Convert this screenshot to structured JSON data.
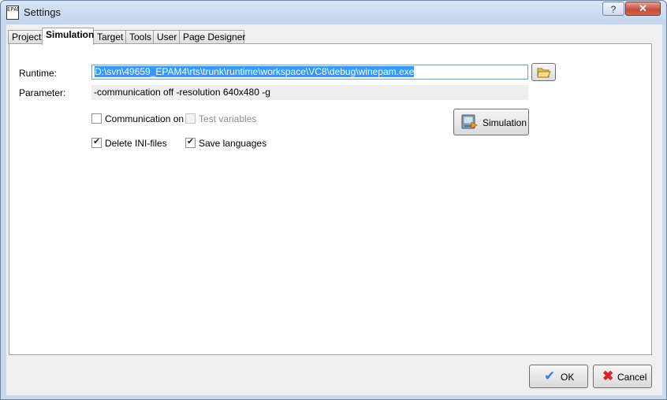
{
  "window": {
    "title": "Settings",
    "app_icon_text": "EPAM",
    "help_glyph": "?",
    "close_glyph": "✕"
  },
  "tabs": [
    {
      "label": "Project"
    },
    {
      "label": "Simulation",
      "active": true
    },
    {
      "label": "Target"
    },
    {
      "label": "Tools"
    },
    {
      "label": "User"
    },
    {
      "label": "Page Designer"
    }
  ],
  "form": {
    "runtime_label": "Runtime:",
    "runtime_value": "D:\\svn\\49659_EPAM4\\rts\\trunk\\runtime\\workspace\\VC8\\debug\\winepam.exe",
    "parameter_label": "Parameter:",
    "parameter_value": "-communication off -resolution 640x480 -g",
    "communication_label": "Communication on",
    "communication_checked": false,
    "test_variables_label": "Test variables",
    "test_variables_checked": false,
    "test_variables_enabled": false,
    "delete_ini_label": "Delete INI-files",
    "delete_ini_checked": true,
    "save_languages_label": "Save languages",
    "save_languages_checked": true,
    "simulation_button": "Simulation"
  },
  "footer": {
    "ok_label": "OK",
    "cancel_label": "Cancel"
  },
  "icons": {
    "browse": "folder-open-icon",
    "simulation": "simulation-monitor-icon",
    "ok": "checkmark-icon",
    "cancel": "red-x-icon"
  }
}
